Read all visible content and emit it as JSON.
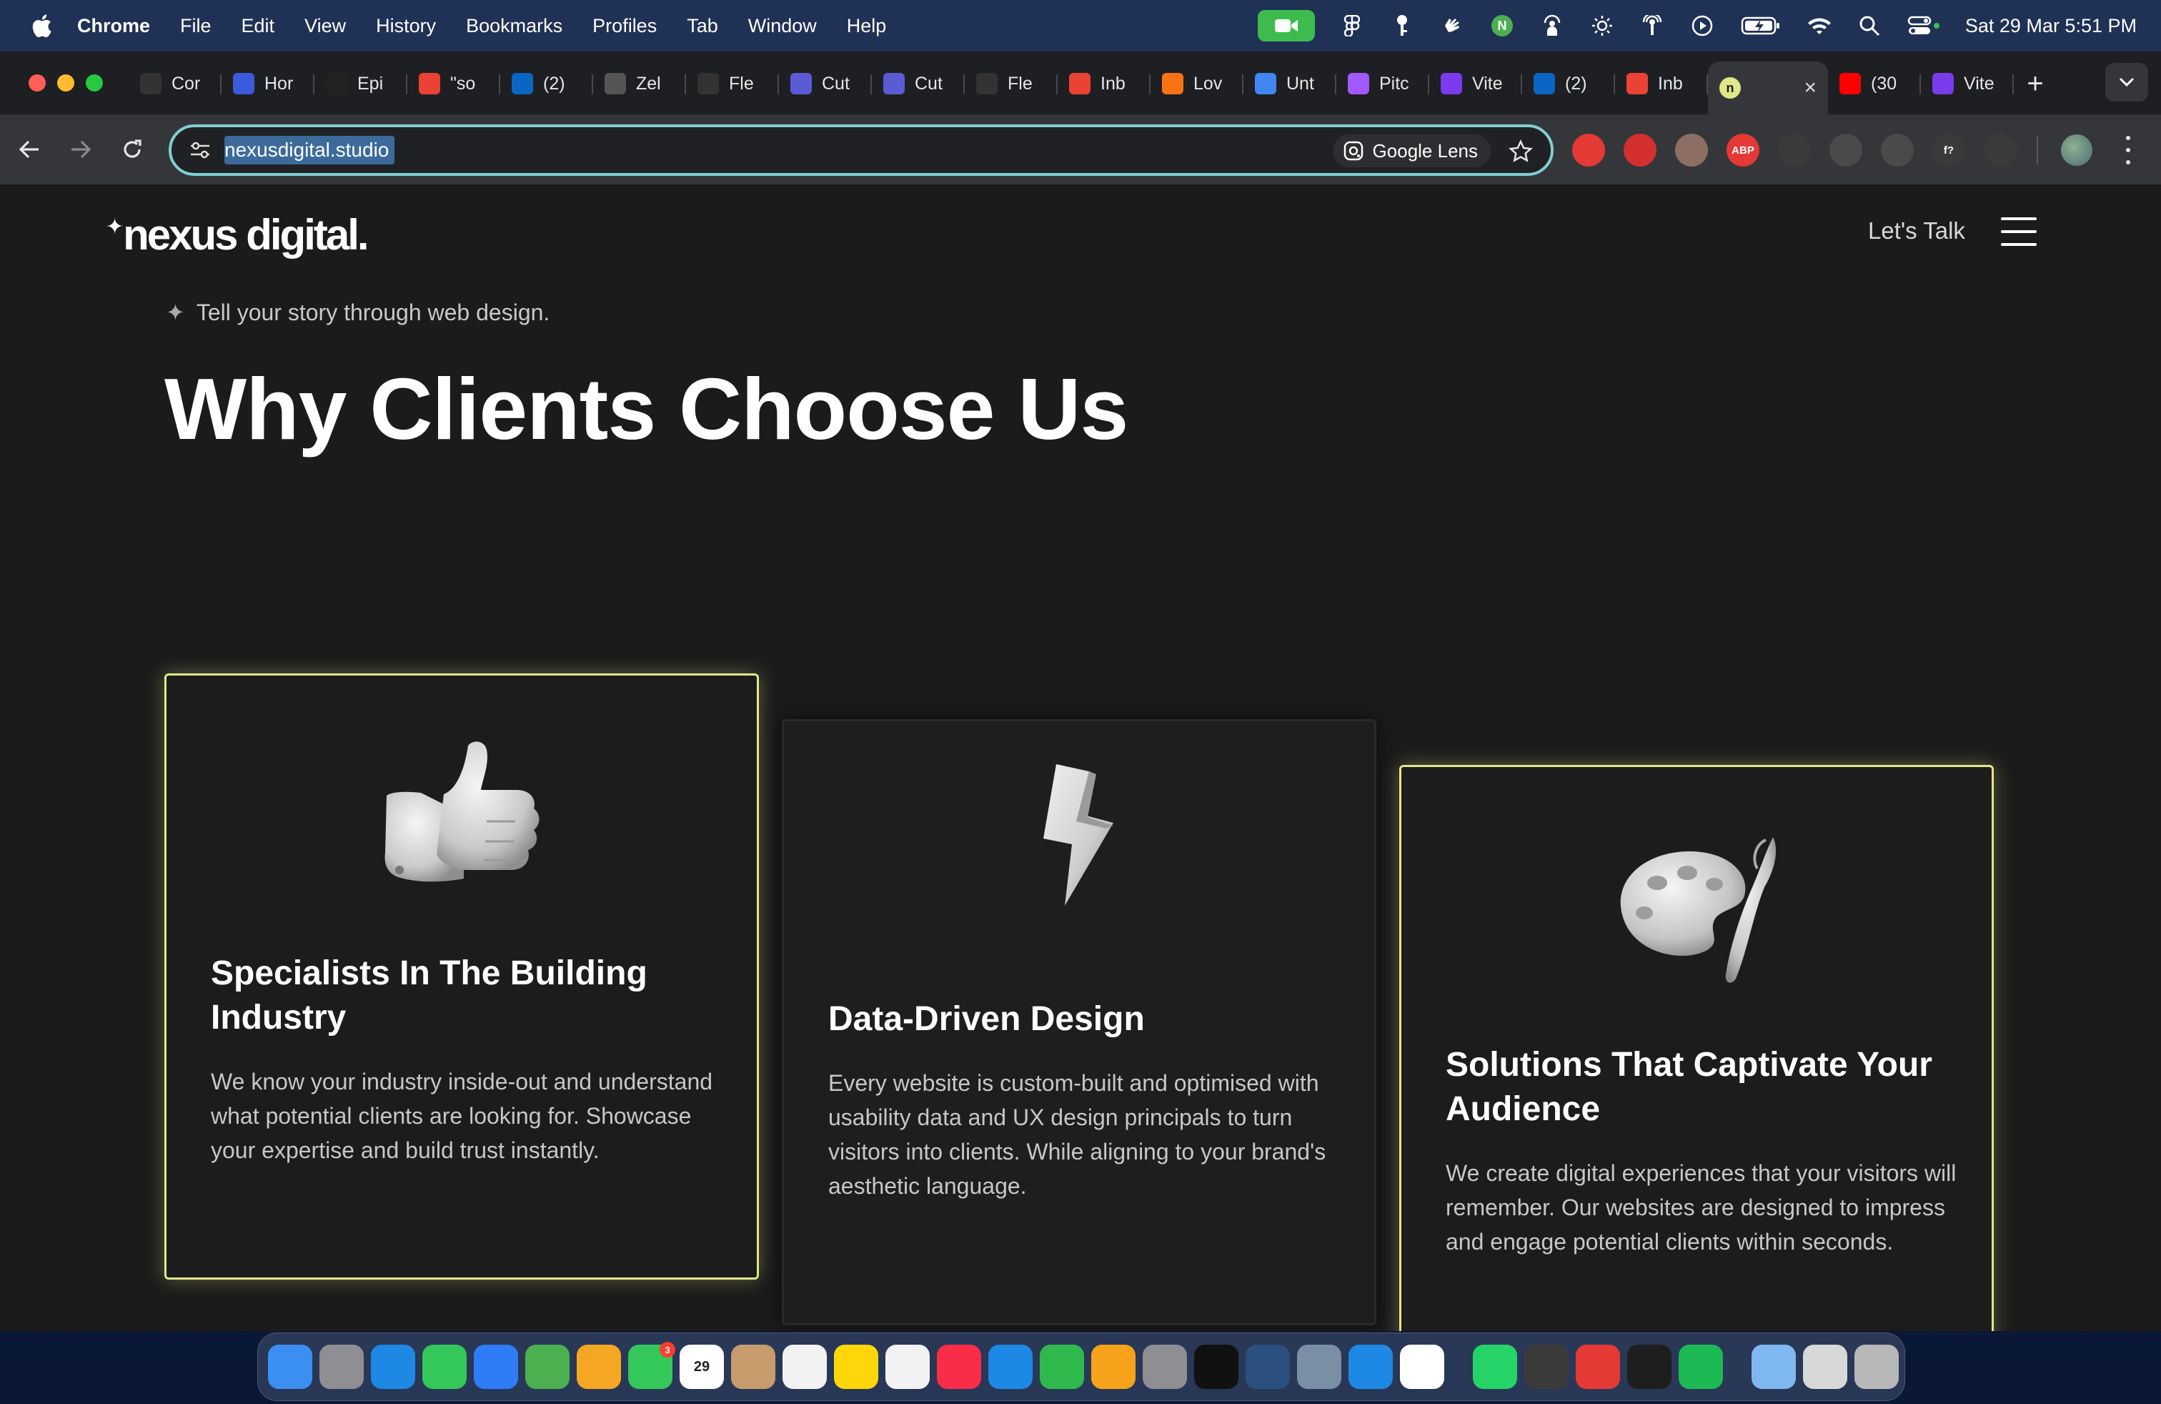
{
  "menubar": {
    "app_name": "Chrome",
    "items": [
      "File",
      "Edit",
      "View",
      "History",
      "Bookmarks",
      "Profiles",
      "Tab",
      "Window",
      "Help"
    ],
    "clock": "Sat 29 Mar  5:51 PM",
    "status_icons": [
      "facetime-icon",
      "figma-icon",
      "key-icon",
      "hand-icon",
      "n-app-icon",
      "person-broadcast-icon",
      "brightness-icon",
      "airdrop-icon",
      "play-circle-icon",
      "battery-icon",
      "wifi-icon",
      "search-icon",
      "control-center-icon"
    ],
    "facetime_color": "#3dbb4f"
  },
  "tabs": [
    {
      "label": "Cor",
      "icon": "openai-icon",
      "color": "#333333"
    },
    {
      "label": "Hor",
      "icon": "k-icon",
      "color": "#3b5bdb"
    },
    {
      "label": "Epi",
      "icon": "grid-icon",
      "color": "#222222"
    },
    {
      "label": "\"so",
      "icon": "gmail-icon",
      "color": "#ea4335"
    },
    {
      "label": "(2)",
      "icon": "linkedin-icon",
      "color": "#0a66c2"
    },
    {
      "label": "Zel",
      "icon": "pen-icon",
      "color": "#555555"
    },
    {
      "label": "Fle",
      "icon": "fx-icon",
      "color": "#333333"
    },
    {
      "label": "Cut",
      "icon": "c-icon",
      "color": "#5b5bd6"
    },
    {
      "label": "Cut",
      "icon": "c-icon",
      "color": "#5b5bd6"
    },
    {
      "label": "Fle",
      "icon": "fx-icon",
      "color": "#333333"
    },
    {
      "label": "Inb",
      "icon": "gmail-icon",
      "color": "#ea4335"
    },
    {
      "label": "Lov",
      "icon": "heart-icon",
      "color": "#f97316"
    },
    {
      "label": "Unt",
      "icon": "docs-icon",
      "color": "#4285f4"
    },
    {
      "label": "Pitc",
      "icon": "figma-icon",
      "color": "#a259ff"
    },
    {
      "label": "Vite",
      "icon": "vite-icon",
      "color": "#7c3aed"
    },
    {
      "label": "(2)",
      "icon": "linkedin-icon",
      "color": "#0a66c2"
    },
    {
      "label": "Inb",
      "icon": "gmail-icon",
      "color": "#ea4335"
    },
    {
      "label": "",
      "icon": "n-app-icon",
      "color": "#e1e68a",
      "active": true
    },
    {
      "label": "(30",
      "icon": "youtube-icon",
      "color": "#ff0000"
    },
    {
      "label": "Vite",
      "icon": "vite-icon",
      "color": "#7c3aed"
    }
  ],
  "toolbar": {
    "url": "nexusdigital.studio",
    "lens_label": "Google Lens",
    "extensions": [
      {
        "icon": "pokeball-icon",
        "color": "#e53935",
        "text": ""
      },
      {
        "icon": "hand-stop-icon",
        "color": "#d32f2f",
        "text": ""
      },
      {
        "icon": "glasses-icon",
        "color": "#8d6e63",
        "text": ""
      },
      {
        "icon": "adblock-icon",
        "color": "#e53935",
        "text": "ABP"
      },
      {
        "icon": "eyedropper-icon",
        "color": "#3a3a3a",
        "text": ""
      },
      {
        "icon": "shield-icon",
        "color": "#4a4a4a",
        "text": ""
      },
      {
        "icon": "compass-icon",
        "color": "#4a4a4a",
        "text": ""
      },
      {
        "icon": "font-icon",
        "color": "#3a3a3a",
        "text": "f?"
      },
      {
        "icon": "puzzle-icon",
        "color": "#3a3a3a",
        "text": ""
      }
    ]
  },
  "site": {
    "logo": "nexus digital.",
    "cta": "Let's Talk",
    "tagline": "Tell your story through web design.",
    "headline": "Why Clients Choose Us",
    "accent_color": "#e1e68a",
    "cards": [
      {
        "title": "Specialists In The Building Industry",
        "body": "We know your industry inside-out and understand what potential clients are looking for. Showcase your expertise and build trust instantly.",
        "icon": "thumbs-up-icon"
      },
      {
        "title": "Data-Driven Design",
        "body": "Every website is custom-built and optimised with usability data and UX design principals to turn visitors into clients. While aligning to your brand's aesthetic language.",
        "icon": "lightning-icon"
      },
      {
        "title": "Solutions That Captivate Your Audience",
        "body": "We create digital experiences that your visitors will remember. Our websites are designed to impress and engage potential clients within seconds.",
        "icon": "palette-icon"
      }
    ]
  },
  "dock": {
    "apps": [
      {
        "icon": "finder-icon",
        "color": "#3b8ff0"
      },
      {
        "icon": "launchpad-icon",
        "color": "#8e8e93"
      },
      {
        "icon": "safari-icon",
        "color": "#1e88e5"
      },
      {
        "icon": "messages-icon",
        "color": "#34c759"
      },
      {
        "icon": "mail-icon",
        "color": "#2f7cf6"
      },
      {
        "icon": "maps-icon",
        "color": "#4caf50"
      },
      {
        "icon": "photos-icon",
        "color": "#f5a623"
      },
      {
        "icon": "facetime-icon",
        "color": "#34c759",
        "badge": "3"
      },
      {
        "icon": "calendar-icon",
        "color": "#ffffff",
        "text": "29"
      },
      {
        "icon": "contacts-icon",
        "color": "#c69c6d"
      },
      {
        "icon": "reminders-icon",
        "color": "#f2f2f2"
      },
      {
        "icon": "notes-icon",
        "color": "#ffd60a"
      },
      {
        "icon": "freeform-icon",
        "color": "#f2f2f2"
      },
      {
        "icon": "music-icon",
        "color": "#fa2d48"
      },
      {
        "icon": "keynote-icon",
        "color": "#1e88e5"
      },
      {
        "icon": "numbers-icon",
        "color": "#2fb94d"
      },
      {
        "icon": "pages-icon",
        "color": "#f7a21b"
      },
      {
        "icon": "settings-icon",
        "color": "#8e8e93"
      },
      {
        "icon": "terminal-icon",
        "color": "#111111"
      },
      {
        "icon": "mysql-icon",
        "color": "#2b4f7e"
      },
      {
        "icon": "preview-icon",
        "color": "#7a8fa6"
      },
      {
        "icon": "app-store-icon",
        "color": "#1e88e5"
      },
      {
        "icon": "chrome-icon",
        "color": "#ffffff"
      },
      {
        "icon": "whatsapp-icon",
        "color": "#25d366"
      },
      {
        "icon": "affinity-icon",
        "color": "#3a3a3a"
      },
      {
        "icon": "acrobat-icon",
        "color": "#e53935"
      },
      {
        "icon": "figma-icon",
        "color": "#1e1e1e"
      },
      {
        "icon": "spotify-icon",
        "color": "#1db954"
      },
      {
        "icon": "folder-icon",
        "color": "#7fb8f0"
      },
      {
        "icon": "stack-icon",
        "color": "#d8d8d8"
      },
      {
        "icon": "trash-icon",
        "color": "#b8b8b8"
      }
    ]
  }
}
